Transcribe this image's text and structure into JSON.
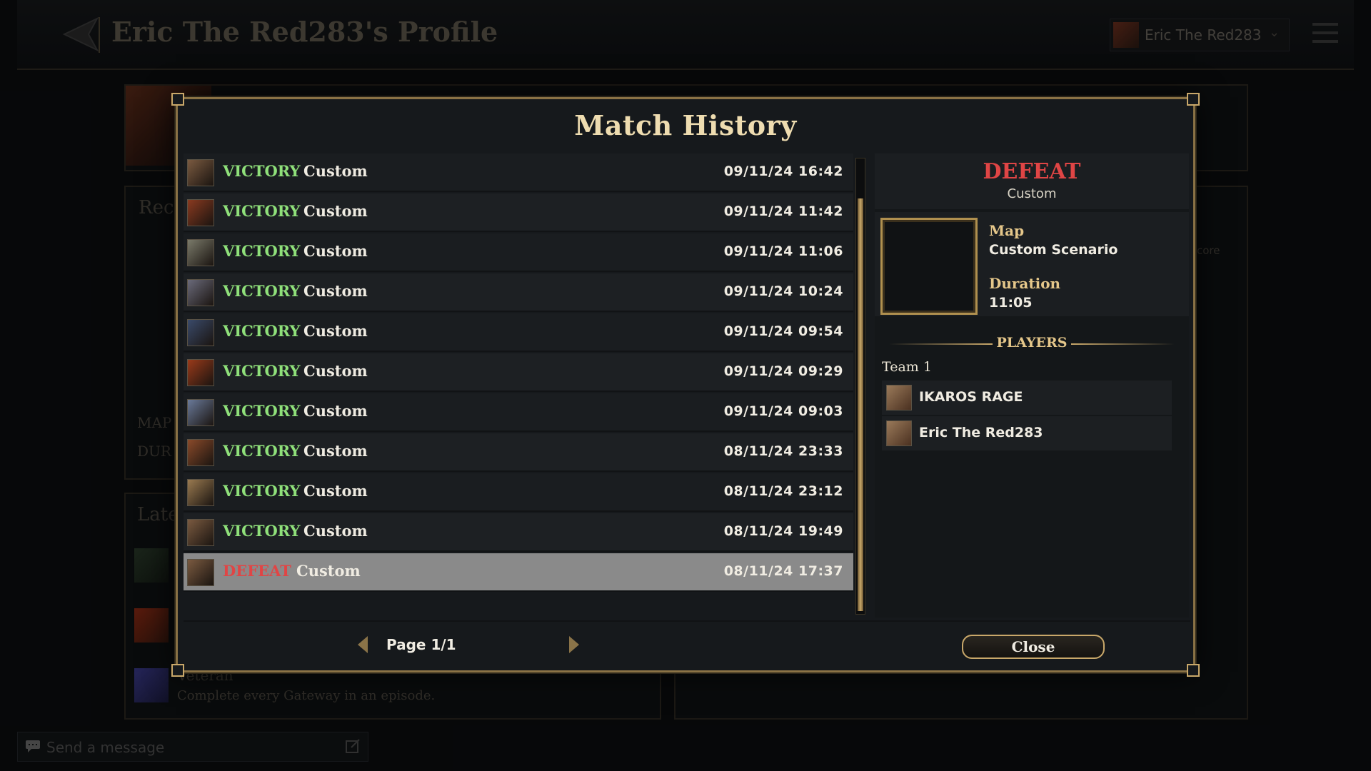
{
  "background": {
    "profile_title": "Eric The Red283's Profile",
    "user_chip_name": "Eric The Red283",
    "left_fragments": [
      "Rec",
      "MAP",
      "DUR",
      "Late"
    ],
    "right_fragment": "core",
    "achievement_title": "Veteran",
    "achievement_desc": "Complete every Gateway in an episode.",
    "message_placeholder": "Send a message"
  },
  "modal": {
    "title": "Match History",
    "matches": [
      {
        "result": "VICTORY",
        "mode": "Custom",
        "date": "09/11/24 16:42",
        "avatar_color": "#7a5a40"
      },
      {
        "result": "VICTORY",
        "mode": "Custom",
        "date": "09/11/24 11:42",
        "avatar_color": "#8a3a20"
      },
      {
        "result": "VICTORY",
        "mode": "Custom",
        "date": "09/11/24 11:06",
        "avatar_color": "#7a7a6a"
      },
      {
        "result": "VICTORY",
        "mode": "Custom",
        "date": "09/11/24 10:24",
        "avatar_color": "#6a6a7a"
      },
      {
        "result": "VICTORY",
        "mode": "Custom",
        "date": "09/11/24 09:54",
        "avatar_color": "#3a4a6a"
      },
      {
        "result": "VICTORY",
        "mode": "Custom",
        "date": "09/11/24 09:29",
        "avatar_color": "#9a3a1a"
      },
      {
        "result": "VICTORY",
        "mode": "Custom",
        "date": "09/11/24 09:03",
        "avatar_color": "#6a7a9a"
      },
      {
        "result": "VICTORY",
        "mode": "Custom",
        "date": "08/11/24 23:33",
        "avatar_color": "#8a4a2a"
      },
      {
        "result": "VICTORY",
        "mode": "Custom",
        "date": "08/11/24 23:12",
        "avatar_color": "#9a7a50"
      },
      {
        "result": "VICTORY",
        "mode": "Custom",
        "date": "08/11/24 19:49",
        "avatar_color": "#7a5a40"
      },
      {
        "result": "DEFEAT",
        "mode": "Custom",
        "date": "08/11/24 17:37",
        "avatar_color": "#7a5a40",
        "selected": true
      }
    ],
    "detail": {
      "result": "DEFEAT",
      "mode": "Custom",
      "map_label": "Map",
      "map_value": "Custom Scenario",
      "duration_label": "Duration",
      "duration_value": "11:05",
      "players_label": "PLAYERS",
      "team_label": "Team 1",
      "players": [
        {
          "name": "IKAROS RAGE"
        },
        {
          "name": "Eric The Red283"
        }
      ]
    },
    "pager_label": "Page 1/1",
    "close_label": "Close"
  },
  "colors": {
    "victory": "#8fe07a",
    "defeat": "#e04545",
    "gold_accent": "#c9a86a"
  }
}
